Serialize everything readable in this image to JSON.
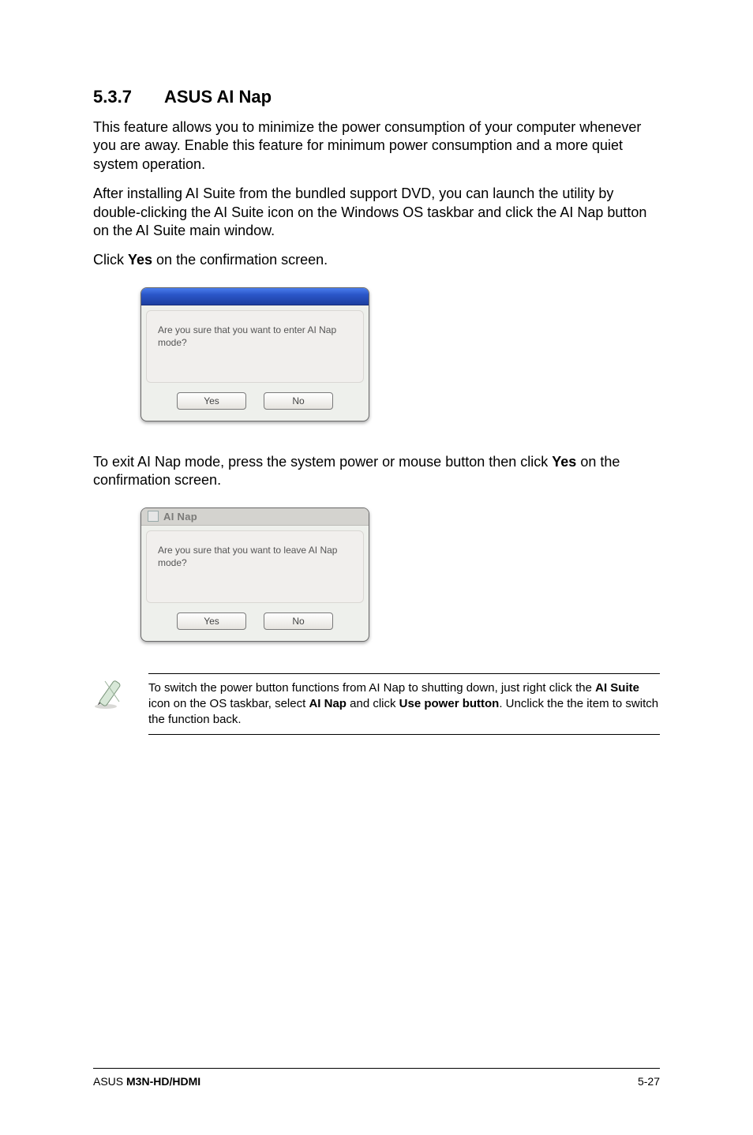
{
  "heading": {
    "num": "5.3.7",
    "title": "ASUS AI Nap"
  },
  "para1": "This feature allows you to minimize the power consumption of your computer whenever you are away. Enable this feature for minimum power consumption and a more quiet system operation.",
  "para2": "After installing AI Suite from the bundled support DVD, you can launch the utility by double-clicking the AI Suite icon on the Windows OS taskbar and click the AI Nap button on the AI Suite main window.",
  "para3_pre": "Click ",
  "para3_bold": "Yes",
  "para3_post": " on the confirmation screen.",
  "dialog1": {
    "message": "Are you sure that you want to enter AI Nap mode?",
    "yes": "Yes",
    "no": "No"
  },
  "para4_pre": "To exit AI Nap mode, press the system power or mouse button then click ",
  "para4_bold": "Yes",
  "para4_post": " on the confirmation screen.",
  "dialog2": {
    "title": "AI Nap",
    "message": "Are you sure that you want to leave AI Nap mode?",
    "yes": "Yes",
    "no": "No"
  },
  "note": {
    "t1": "To switch the power button functions from AI Nap to shutting down, just right click the ",
    "b1": "AI Suite",
    "t2": " icon on the OS taskbar, select ",
    "b2": "AI Nap",
    "t3": " and click ",
    "b3": "Use power button",
    "t4": ". Unclick the the item to switch the function back."
  },
  "footer": {
    "left_plain": "ASUS ",
    "left_bold": "M3N-HD/HDMI",
    "right": "5-27"
  }
}
